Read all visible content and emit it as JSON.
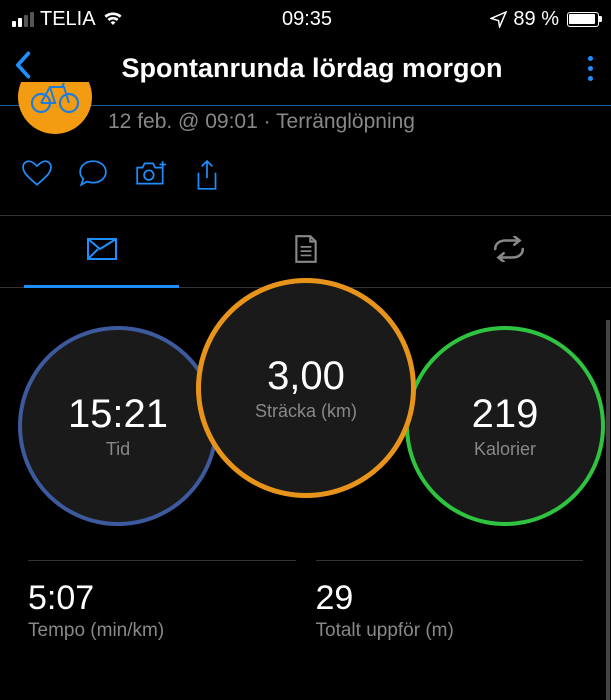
{
  "status_bar": {
    "carrier": "TELIA",
    "time": "09:35",
    "battery_percent": "89 %"
  },
  "header": {
    "title": "Spontanrunda lördag morgon"
  },
  "activity": {
    "meta": "12 feb. @ 09:01 · Terränglöpning"
  },
  "gauges": {
    "time": {
      "value": "15:21",
      "label": "Tid"
    },
    "distance": {
      "value": "3,00",
      "label": "Sträcka (km)"
    },
    "calories": {
      "value": "219",
      "label": "Kalorier"
    }
  },
  "stats": {
    "pace": {
      "value": "5:07",
      "label": "Tempo (min/km)"
    },
    "elevation": {
      "value": "29",
      "label": "Totalt uppför (m)"
    }
  }
}
